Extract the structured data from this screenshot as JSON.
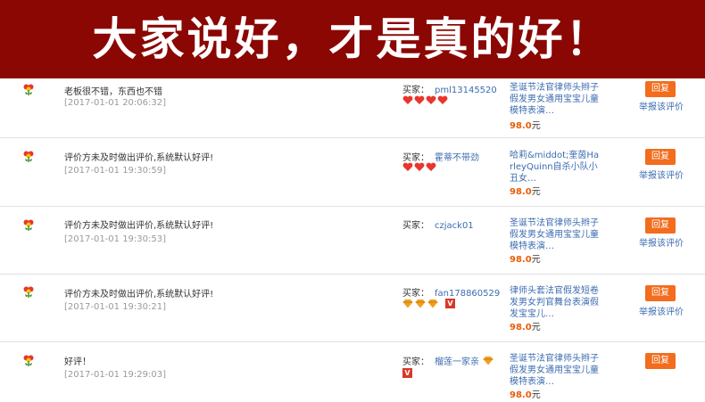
{
  "banner": {
    "title": "大家说好，才是真的好！"
  },
  "colors": {
    "banner_bg": "#8a0703",
    "link": "#3d6cb0",
    "reply_btn": "#f26d1e",
    "price": "#e85d0a",
    "heart": "#e8362f",
    "diamond": "#f0a020"
  },
  "reviews": [
    {
      "comment": "老板很不错，东西也不错",
      "date": "[2017-01-01 20:06:32]",
      "buyer_label": "买家：",
      "buyer_name": "pml13145520",
      "hearts": 4,
      "diamonds": 0,
      "vip": false,
      "product": "圣诞节法官律师头辫子假发男女通用宝宝儿童模特表演…",
      "price": "98.0",
      "price_unit": "元",
      "reply": "回复",
      "report": "举报该评价"
    },
    {
      "comment": "评价方未及时做出评价,系统默认好评!",
      "date": "[2017-01-01 19:30:59]",
      "buyer_label": "买家：",
      "buyer_name": "霍蒂不带劲",
      "hearts": 3,
      "diamonds": 0,
      "vip": false,
      "product": "哈莉&middot;奎茵HarleyQuinn自杀小队小丑女…",
      "price": "98.0",
      "price_unit": "元",
      "reply": "回复",
      "report": "举报该评价"
    },
    {
      "comment": "评价方未及时做出评价,系统默认好评!",
      "date": "[2017-01-01 19:30:53]",
      "buyer_label": "买家：",
      "buyer_name": "czjack01",
      "hearts": 0,
      "diamonds": 0,
      "vip": false,
      "product": "圣诞节法官律师头辫子假发男女通用宝宝儿童模特表演…",
      "price": "98.0",
      "price_unit": "元",
      "reply": "回复",
      "report": "举报该评价"
    },
    {
      "comment": "评价方未及时做出评价,系统默认好评!",
      "date": "[2017-01-01 19:30:21]",
      "buyer_label": "买家：",
      "buyer_name": "fan178860529",
      "hearts": 0,
      "diamonds": 3,
      "vip": true,
      "vip_text": "V",
      "product": "律师头套法官假发短卷发男女判官舞台表演假发宝宝儿…",
      "price": "98.0",
      "price_unit": "元",
      "reply": "回复",
      "report": "举报该评价"
    },
    {
      "comment": "好评！",
      "date": "[2017-01-01 19:29:03]",
      "buyer_label": "买家：",
      "buyer_name": "榴莲一家亲",
      "hearts": 0,
      "diamonds": 1,
      "vip": true,
      "vip_text": "V",
      "product": "圣诞节法官律师头辫子假发男女通用宝宝儿童模特表演…",
      "price": "98.0",
      "price_unit": "元",
      "reply": "回复",
      "report": ""
    }
  ]
}
